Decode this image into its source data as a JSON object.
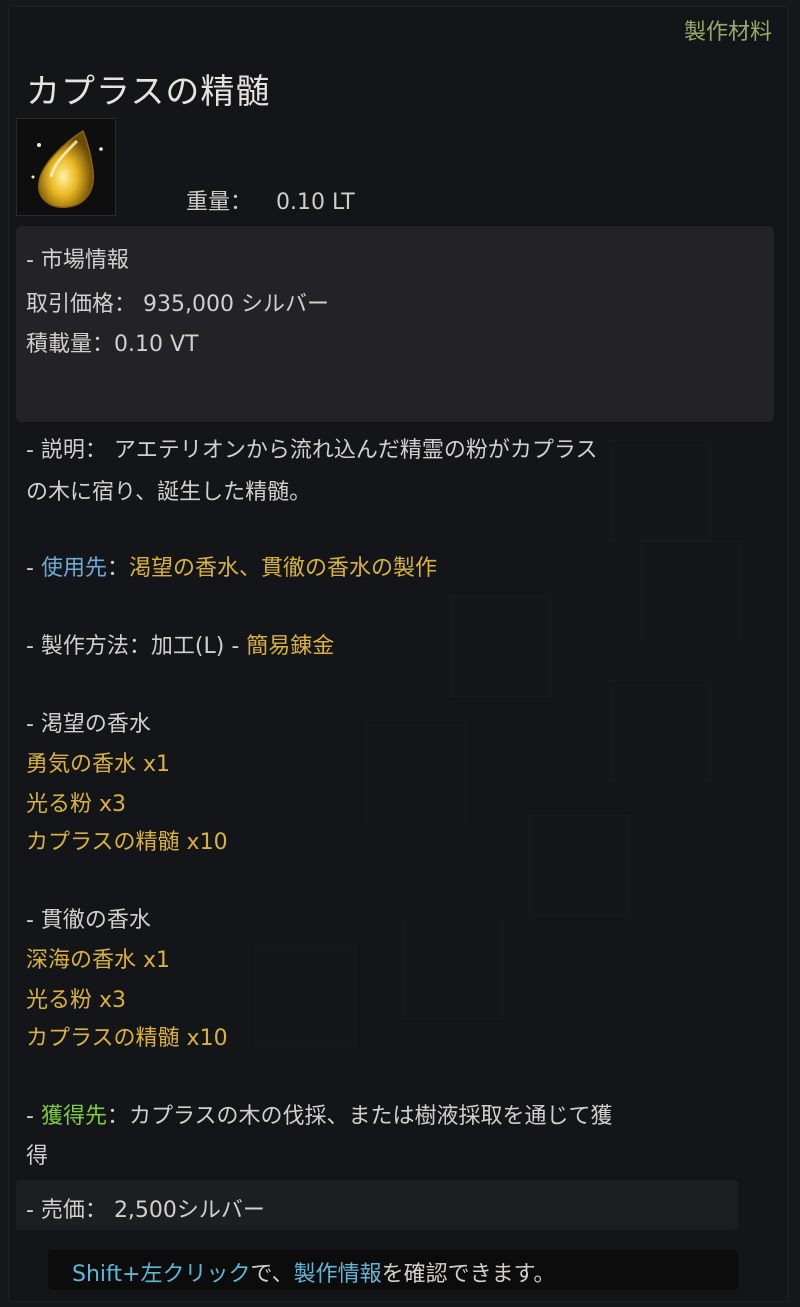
{
  "tooltip": {
    "category": "製作材料",
    "item_name": "カプラスの精髄",
    "icon": "golden-tear-gem-icon",
    "weight_label": "重量：",
    "weight_value": "0.10 LT"
  },
  "market": {
    "header": "- 市場情報",
    "trade_price": "取引価格： 935,000 シルバー",
    "load": "積載量：0.10 VT"
  },
  "description": {
    "line1": "- 説明： アエテリオンから流れ込んだ精霊の粉がカプラス",
    "line2": "の木に宿り、誕生した精髄。"
  },
  "usage": {
    "prefix": "- ",
    "label": "使用先",
    "separator": "：",
    "value": "渇望の香水、貫徹の香水の製作"
  },
  "craft_method": {
    "text": "- 製作方法：加工(L) - ",
    "value": "簡易錬金"
  },
  "recipe1": {
    "title": "- 渇望の香水",
    "items": [
      "勇気の香水 x1",
      "光る粉 x3",
      "カプラスの精髄 x10"
    ]
  },
  "recipe2": {
    "title": "- 貫徹の香水",
    "items": [
      "深海の香水 x1",
      "光る粉 x3",
      "カプラスの精髄 x10"
    ]
  },
  "obtain": {
    "prefix": "- ",
    "label": "獲得先",
    "line1": "：カプラスの木の伐採、または樹液採取を通じて獲",
    "line2": "得"
  },
  "sell": {
    "label": "- 売価：",
    "value": "2,500シルバー"
  },
  "hint": {
    "key1": "Shift+左クリック",
    "text1": "で、",
    "key2": "製作情報",
    "text2": "を確認できます。"
  },
  "colors": {
    "usage": "#6fa9d8",
    "material": "#d8b23c",
    "obtain": "#7ccd3c",
    "category": "#9aa86a"
  }
}
